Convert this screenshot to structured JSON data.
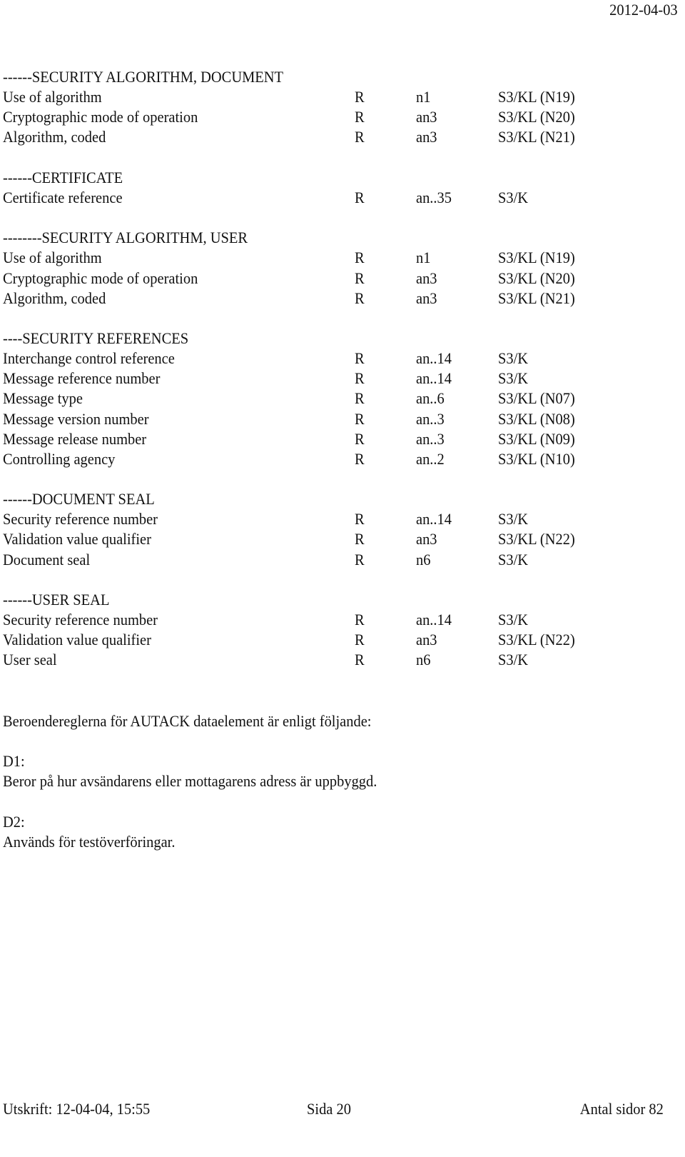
{
  "header": {
    "date": "2012-04-03"
  },
  "sections": [
    {
      "title": "------SECURITY ALGORITHM, DOCUMENT",
      "rows": [
        {
          "label": "Use of algorithm",
          "req": "R",
          "format": "n1",
          "status": "S3/KL (N19)"
        },
        {
          "label": "Cryptographic mode of operation",
          "req": "R",
          "format": "an3",
          "status": "S3/KL (N20)"
        },
        {
          "label": "Algorithm, coded",
          "req": "R",
          "format": "an3",
          "status": "S3/KL (N21)"
        }
      ]
    },
    {
      "title": "------CERTIFICATE",
      "rows": [
        {
          "label": "Certificate reference",
          "req": "R",
          "format": "an..35",
          "status": "S3/K"
        }
      ]
    },
    {
      "title": "--------SECURITY ALGORITHM, USER",
      "rows": [
        {
          "label": "Use of algorithm",
          "req": "R",
          "format": "n1",
          "status": "S3/KL (N19)"
        },
        {
          "label": "Cryptographic mode of operation",
          "req": "R",
          "format": "an3",
          "status": "S3/KL (N20)"
        },
        {
          "label": "Algorithm, coded",
          "req": "R",
          "format": "an3",
          "status": "S3/KL (N21)"
        }
      ]
    },
    {
      "title": "----SECURITY REFERENCES",
      "rows": [
        {
          "label": "Interchange control reference",
          "req": "R",
          "format": "an..14",
          "status": "S3/K"
        },
        {
          "label": "Message reference number",
          "req": "R",
          "format": "an..14",
          "status": "S3/K"
        },
        {
          "label": "Message type",
          "req": "R",
          "format": "an..6",
          "status": "S3/KL (N07)"
        },
        {
          "label": "Message version number",
          "req": "R",
          "format": "an..3",
          "status": "S3/KL (N08)"
        },
        {
          "label": "Message release number",
          "req": "R",
          "format": "an..3",
          "status": "S3/KL (N09)"
        },
        {
          "label": "Controlling agency",
          "req": "R",
          "format": "an..2",
          "status": "S3/KL (N10)"
        }
      ]
    },
    {
      "title": "------DOCUMENT SEAL",
      "rows": [
        {
          "label": "Security reference number",
          "req": "R",
          "format": "an..14",
          "status": "S3/K"
        },
        {
          "label": "Validation value qualifier",
          "req": "R",
          "format": "an3",
          "status": "S3/KL (N22)"
        },
        {
          "label": "Document seal",
          "req": "R",
          "format": "n6",
          "status": "S3/K"
        }
      ]
    },
    {
      "title": "------USER SEAL",
      "rows": [
        {
          "label": "Security reference number",
          "req": "R",
          "format": "an..14",
          "status": "S3/K"
        },
        {
          "label": "Validation value qualifier",
          "req": "R",
          "format": "an3",
          "status": "S3/KL (N22)"
        },
        {
          "label": "User seal",
          "req": "R",
          "format": "n6",
          "status": "S3/K"
        }
      ]
    }
  ],
  "rules": {
    "intro": "Beroendereglerna för AUTACK dataelement är enligt följande:",
    "items": [
      {
        "id": "D1:",
        "text": "Beror på hur avsändarens eller mottagarens adress är uppbyggd."
      },
      {
        "id": "D2:",
        "text": "Används för testöverföringar."
      }
    ]
  },
  "footer": {
    "printed": "Utskrift: 12-04-04, 15:55",
    "page": "Sida 20",
    "total_pages": "Antal sidor 82"
  }
}
